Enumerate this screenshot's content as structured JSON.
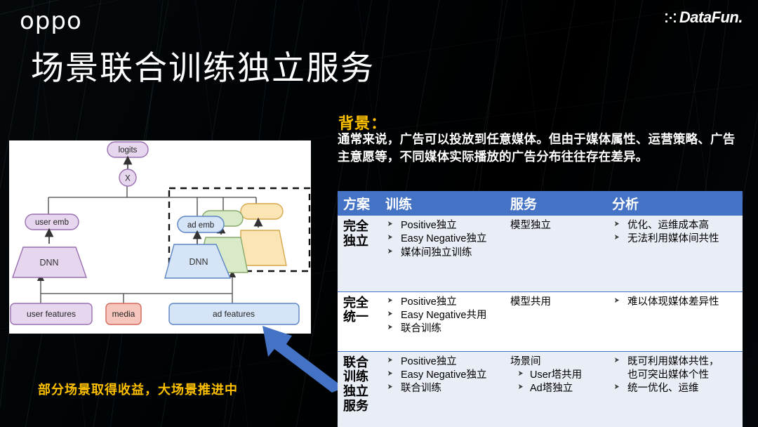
{
  "brand": {
    "oppo_logo_text": "oppo",
    "datafun_logo_text": "DataFun."
  },
  "page_title": "场景联合训练独立服务",
  "bottom_note": "部分场景取得收益，大场景推进中",
  "background_section": {
    "heading": "背景：",
    "body": "通常来说，广告可以投放到任意媒体。但由于媒体属性、运营策略、广告主意愿等，不同媒体实际播放的广告分布往往存在差异。"
  },
  "diagram": {
    "nodes": {
      "logits": "logits",
      "multiply": "X",
      "user_emb": "user emb",
      "ad_emb": "ad emb",
      "user_dnn": "DNN",
      "ad_dnn": "DNN",
      "user_features": "user features",
      "media": "media",
      "ad_features": "ad features"
    },
    "colors": {
      "purple_fill": "#E6D7EE",
      "purple_stroke": "#9A6FB0",
      "blue_fill": "#D6E4F7",
      "blue_stroke": "#5B84C4",
      "green_fill": "#D9EAC8",
      "green_stroke": "#86A86A",
      "yellow_fill": "#FCE5B5",
      "yellow_stroke": "#D4A94B",
      "red_fill": "#F6C5BC",
      "red_stroke": "#D4695A"
    }
  },
  "table": {
    "headers": [
      "方案",
      "训练",
      "服务",
      "分析"
    ],
    "rows": [
      {
        "scheme": "完全\n独立",
        "scheme_lines": [
          "完全",
          "独立"
        ],
        "training": [
          "Positive独立",
          "Easy Negative独立",
          "媒体间独立训练"
        ],
        "service_plain": "模型独立",
        "service_bullets": [],
        "analysis": [
          "优化、运维成本高",
          "无法利用媒体间共性"
        ]
      },
      {
        "scheme_lines": [
          "完全",
          "统一"
        ],
        "training": [
          "Positive独立",
          "Easy Negative共用",
          "联合训练"
        ],
        "service_plain": "模型共用",
        "service_bullets": [],
        "analysis": [
          "难以体现媒体差异性"
        ]
      },
      {
        "scheme_lines": [
          "联合",
          "训练",
          "独立",
          "服务"
        ],
        "training": [
          "Positive独立",
          "Easy Negative独立",
          "联合训练"
        ],
        "service_plain": "场景间",
        "service_bullets": [
          "User塔共用",
          "Ad塔独立"
        ],
        "analysis_mixed": [
          {
            "bullet": true,
            "text": "既可利用媒体共性，"
          },
          {
            "bullet": false,
            "text": "也可突出媒体个性"
          },
          {
            "bullet": true,
            "text": "统一优化、运维"
          }
        ],
        "analysis": [
          "既可利用媒体共性，",
          "也可突出媒体个性",
          "统一优化、运维"
        ]
      }
    ]
  },
  "colors": {
    "header_blue": "#4472C4",
    "row_alt": "#E9EDF6",
    "accent_gold": "#FFC000",
    "arrow_blue": "#4472C4"
  }
}
